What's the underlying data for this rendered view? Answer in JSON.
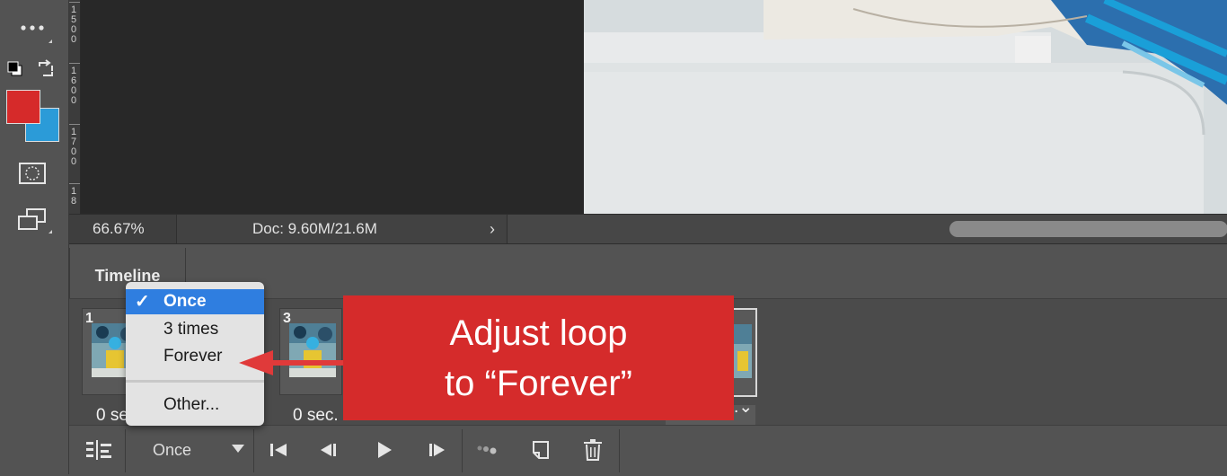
{
  "toolbar": {
    "icons": [
      "more-icon",
      "default-colors-icon",
      "swap-colors-icon",
      "foreground-color-swatch",
      "background-color-swatch",
      "quick-mask-icon",
      "screen-mode-icon"
    ],
    "foreground_color": "#d62a2a",
    "background_color": "#2b9bd8"
  },
  "ruler": {
    "labels": [
      "1500",
      "1600",
      "1700",
      "18"
    ]
  },
  "status": {
    "zoom": "66.67%",
    "doc": "Doc: 9.60M/21.6M",
    "chevron": "›"
  },
  "timeline": {
    "tab_label": "Timeline",
    "frames": [
      {
        "number": "1",
        "delay": "0 sec."
      },
      {
        "number": "3",
        "delay": "0 sec."
      },
      {
        "number": "",
        "delay": "0 sec."
      }
    ],
    "controls": {
      "loop_value": "Once",
      "icons": [
        "convert-timeline-icon",
        "first-frame-icon",
        "previous-frame-icon",
        "play-icon",
        "next-frame-icon",
        "tween-icon",
        "duplicate-frame-icon",
        "delete-frame-icon"
      ]
    }
  },
  "loop_menu": {
    "items": [
      {
        "label": "Once",
        "selected": true
      },
      {
        "label": "3 times",
        "selected": false
      },
      {
        "label": "Forever",
        "selected": false
      },
      {
        "label": "Other...",
        "selected": false
      }
    ]
  },
  "callout": {
    "line1": "Adjust loop",
    "line2": "to “Forever”",
    "color": "#d52b2b"
  }
}
